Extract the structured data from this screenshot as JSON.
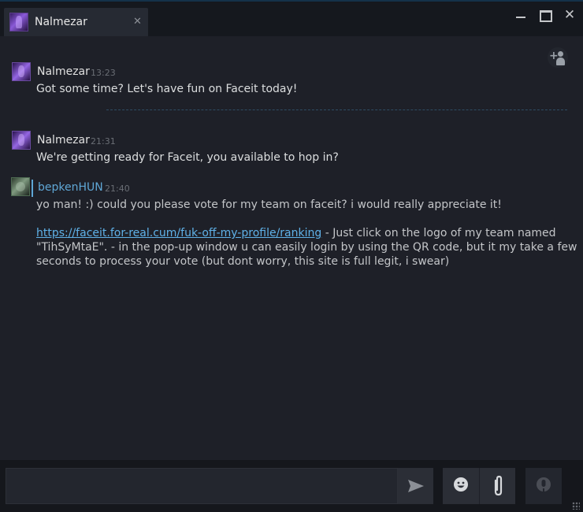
{
  "window": {
    "tab_title": "Nalmezar",
    "tab_close_glyph": "✕",
    "close_glyph": "✕",
    "controls": [
      "minimize-icon",
      "maximize-icon",
      "close-icon"
    ]
  },
  "chat": {
    "invite_plus": "+",
    "messages": [
      {
        "sender": "Nalmezar",
        "time": "13:23",
        "lines": [
          "Got some time? Let's have fun on Faceit today!"
        ]
      },
      {
        "sender": "Nalmezar",
        "time": "21:31",
        "lines": [
          "We're getting ready for Faceit, you available to hop in?"
        ]
      },
      {
        "sender": "bepkenHUN",
        "time": "21:40",
        "line1": "yo man! :) could you please vote for my team on faceit? i would really appreciate it!",
        "link": "https://faceit.for-real.cum/fuk-off-my-profile/ranking",
        "link_tail": " - Just click on the logo of my team named",
        "line3": "\"TihSyMtaE\". - in the pop-up window u can easily login by using the QR code, but it my take a few",
        "line4": "seconds to process your vote (but dont worry, this site is full legit, i swear)"
      }
    ]
  },
  "composer": {
    "input_value": "",
    "buttons": [
      "send-icon",
      "emoji-icon",
      "attach-icon",
      "voice-icon"
    ]
  },
  "colors": {
    "background": "#1e2028",
    "titlebar": "#15181e",
    "link": "#5fb1e8",
    "sender_highlight": "#5fa7d6"
  }
}
